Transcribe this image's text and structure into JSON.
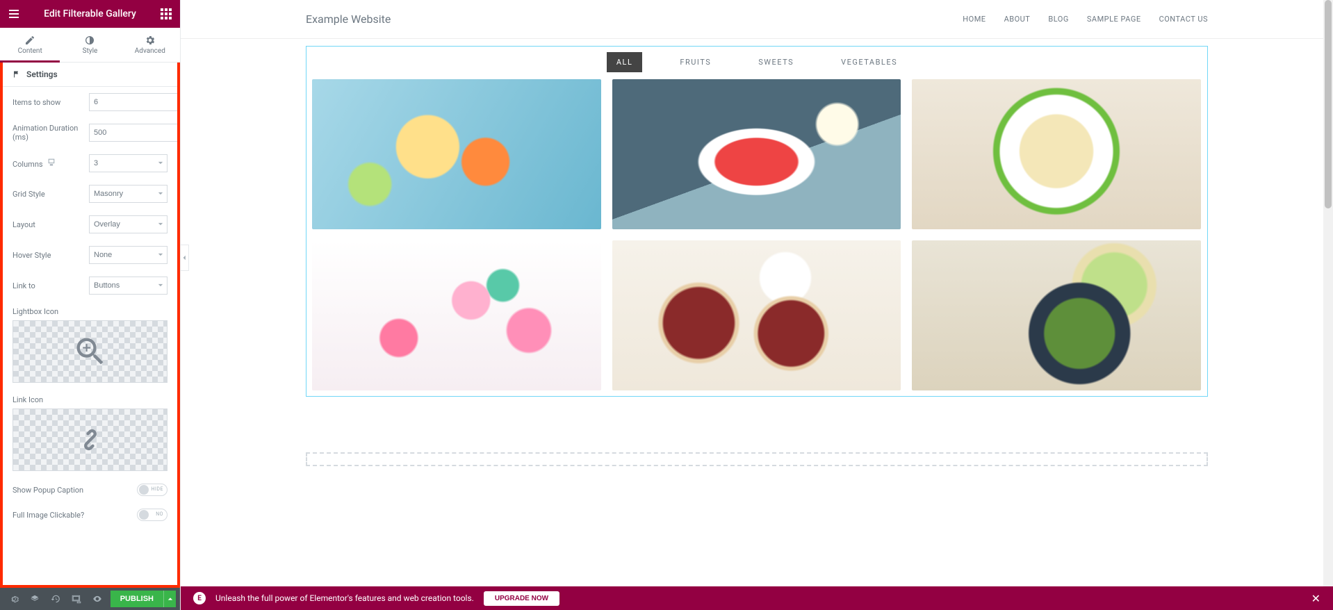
{
  "panel": {
    "title": "Edit Filterable Gallery",
    "tabs": {
      "content": "Content",
      "style": "Style",
      "advanced": "Advanced"
    },
    "section": "Settings",
    "controls": {
      "items_to_show": {
        "label": "Items to show",
        "value": "6"
      },
      "anim_duration": {
        "label": "Animation Duration (ms)",
        "value": "500"
      },
      "columns": {
        "label": "Columns",
        "value": "3"
      },
      "grid_style": {
        "label": "Grid Style",
        "value": "Masonry"
      },
      "layout": {
        "label": "Layout",
        "value": "Overlay"
      },
      "hover_style": {
        "label": "Hover Style",
        "value": "None"
      },
      "link_to": {
        "label": "Link to",
        "value": "Buttons"
      },
      "lightbox_icon": {
        "label": "Lightbox Icon"
      },
      "link_icon": {
        "label": "Link Icon"
      },
      "show_popup_caption": {
        "label": "Show Popup Caption",
        "state": "HIDE"
      },
      "full_image_clickable": {
        "label": "Full Image Clickable?",
        "state": "NO"
      }
    }
  },
  "footer": {
    "publish": "PUBLISH"
  },
  "site": {
    "title": "Example Website",
    "nav": [
      "HOME",
      "ABOUT",
      "BLOG",
      "SAMPLE PAGE",
      "CONTACT US"
    ]
  },
  "filters": [
    "ALL",
    "FRUITS",
    "SWEETS",
    "VEGETABLES"
  ],
  "promo": {
    "text": "Unleash the full power of Elementor's features and web creation tools.",
    "cta": "UPGRADE NOW"
  }
}
